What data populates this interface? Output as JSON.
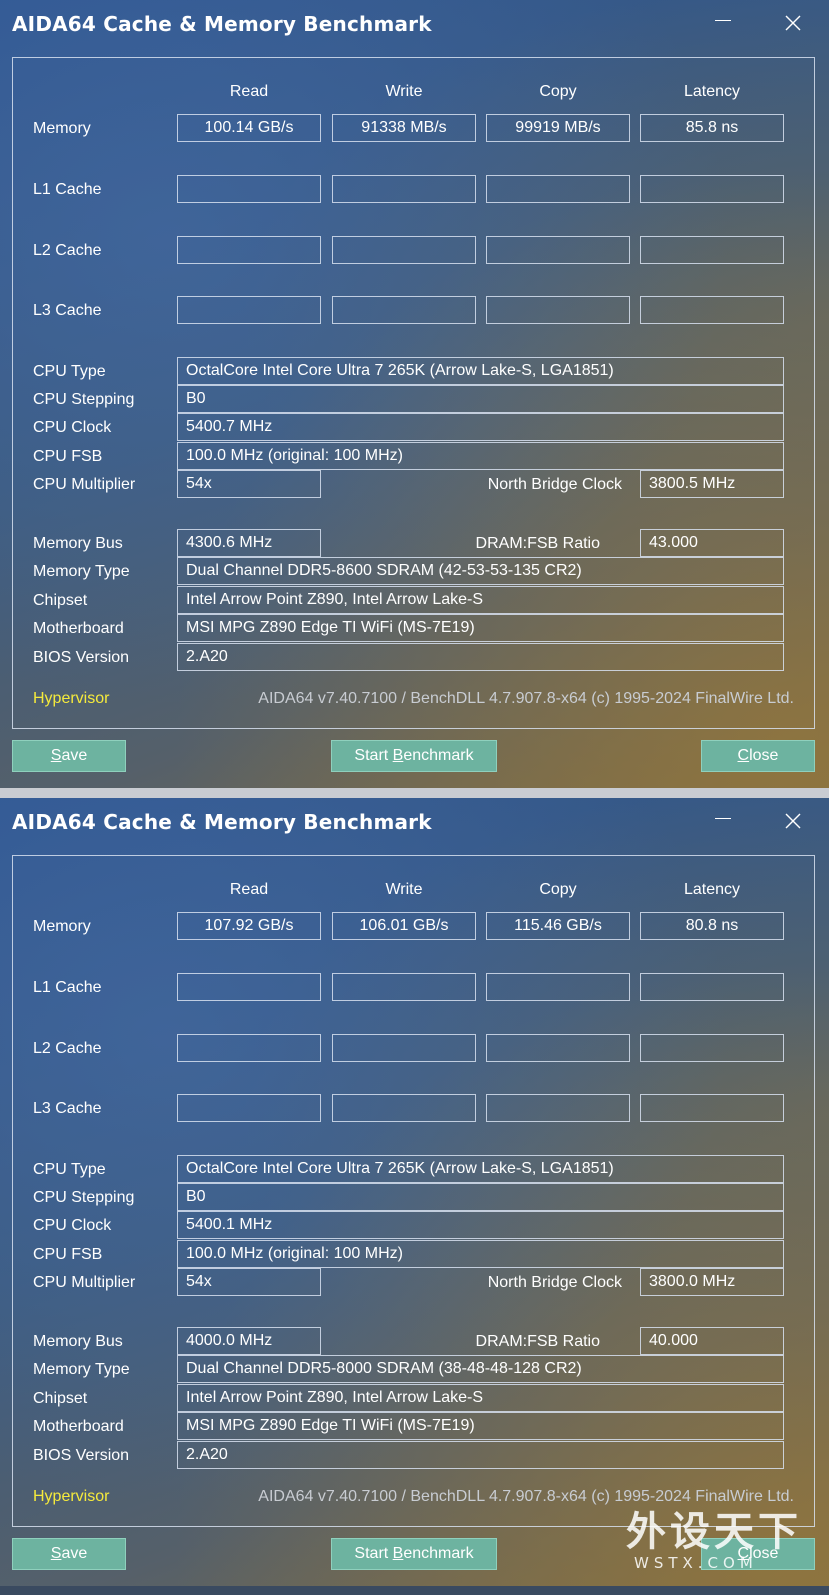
{
  "windows": [
    {
      "title": "AIDA64 Cache & Memory Benchmark",
      "columns": [
        "Read",
        "Write",
        "Copy",
        "Latency"
      ],
      "memory": {
        "label": "Memory",
        "read": "100.14 GB/s",
        "write": "91338 MB/s",
        "copy": "99919 MB/s",
        "latency": "85.8 ns"
      },
      "caches": [
        {
          "label": "L1 Cache"
        },
        {
          "label": "L2 Cache"
        },
        {
          "label": "L3 Cache"
        }
      ],
      "info": {
        "cpu_type": {
          "label": "CPU Type",
          "value": "OctalCore Intel Core Ultra 7 265K  (Arrow Lake-S, LGA1851)"
        },
        "cpu_stepping": {
          "label": "CPU Stepping",
          "value": "B0"
        },
        "cpu_clock": {
          "label": "CPU Clock",
          "value": "5400.7 MHz"
        },
        "cpu_fsb": {
          "label": "CPU FSB",
          "value": "100.0 MHz  (original: 100 MHz)"
        },
        "cpu_multiplier": {
          "label": "CPU Multiplier",
          "value": "54x"
        },
        "north_bridge_clock": {
          "label": "North Bridge Clock",
          "value": "3800.5 MHz"
        },
        "memory_bus": {
          "label": "Memory Bus",
          "value": "4300.6 MHz"
        },
        "dram_fsb_ratio": {
          "label": "DRAM:FSB Ratio",
          "value": "43.000"
        },
        "memory_type": {
          "label": "Memory Type",
          "value": "Dual Channel DDR5-8600 SDRAM  (42-53-53-135 CR2)"
        },
        "chipset": {
          "label": "Chipset",
          "value": "Intel Arrow Point Z890, Intel Arrow Lake-S"
        },
        "motherboard": {
          "label": "Motherboard",
          "value": "MSI MPG Z890 Edge TI WiFi (MS-7E19)"
        },
        "bios_version": {
          "label": "BIOS Version",
          "value": "2.A20"
        }
      },
      "hypervisor": "Hypervisor",
      "version_text": "AIDA64 v7.40.7100 / BenchDLL 4.7.907.8-x64  (c) 1995-2024 FinalWire Ltd.",
      "buttons": {
        "save_pre": "",
        "save_key": "S",
        "save_post": "ave",
        "start_pre": "Start ",
        "start_key": "B",
        "start_post": "enchmark",
        "close_pre": "",
        "close_key": "C",
        "close_post": "lose"
      }
    },
    {
      "title": "AIDA64 Cache & Memory Benchmark",
      "columns": [
        "Read",
        "Write",
        "Copy",
        "Latency"
      ],
      "memory": {
        "label": "Memory",
        "read": "107.92 GB/s",
        "write": "106.01 GB/s",
        "copy": "115.46 GB/s",
        "latency": "80.8 ns"
      },
      "caches": [
        {
          "label": "L1 Cache"
        },
        {
          "label": "L2 Cache"
        },
        {
          "label": "L3 Cache"
        }
      ],
      "info": {
        "cpu_type": {
          "label": "CPU Type",
          "value": "OctalCore Intel Core Ultra 7 265K  (Arrow Lake-S, LGA1851)"
        },
        "cpu_stepping": {
          "label": "CPU Stepping",
          "value": "B0"
        },
        "cpu_clock": {
          "label": "CPU Clock",
          "value": "5400.1 MHz"
        },
        "cpu_fsb": {
          "label": "CPU FSB",
          "value": "100.0 MHz  (original: 100 MHz)"
        },
        "cpu_multiplier": {
          "label": "CPU Multiplier",
          "value": "54x"
        },
        "north_bridge_clock": {
          "label": "North Bridge Clock",
          "value": "3800.0 MHz"
        },
        "memory_bus": {
          "label": "Memory Bus",
          "value": "4000.0 MHz"
        },
        "dram_fsb_ratio": {
          "label": "DRAM:FSB Ratio",
          "value": "40.000"
        },
        "memory_type": {
          "label": "Memory Type",
          "value": "Dual Channel DDR5-8000 SDRAM  (38-48-48-128 CR2)"
        },
        "chipset": {
          "label": "Chipset",
          "value": "Intel Arrow Point Z890, Intel Arrow Lake-S"
        },
        "motherboard": {
          "label": "Motherboard",
          "value": "MSI MPG Z890 Edge TI WiFi (MS-7E19)"
        },
        "bios_version": {
          "label": "BIOS Version",
          "value": "2.A20"
        }
      },
      "hypervisor": "Hypervisor",
      "version_text": "AIDA64 v7.40.7100 / BenchDLL 4.7.907.8-x64  (c) 1995-2024 FinalWire Ltd.",
      "buttons": {
        "save_pre": "",
        "save_key": "S",
        "save_post": "ave",
        "start_pre": "Start ",
        "start_key": "B",
        "start_post": "enchmark",
        "close_pre": "",
        "close_key": "C",
        "close_post": "lose"
      }
    }
  ],
  "watermark": {
    "cn": "外设天下",
    "en": "WSTX.COM"
  },
  "colors": {
    "accent_button": "#6db3a0",
    "hypervisor_text": "#f5ea3c"
  }
}
